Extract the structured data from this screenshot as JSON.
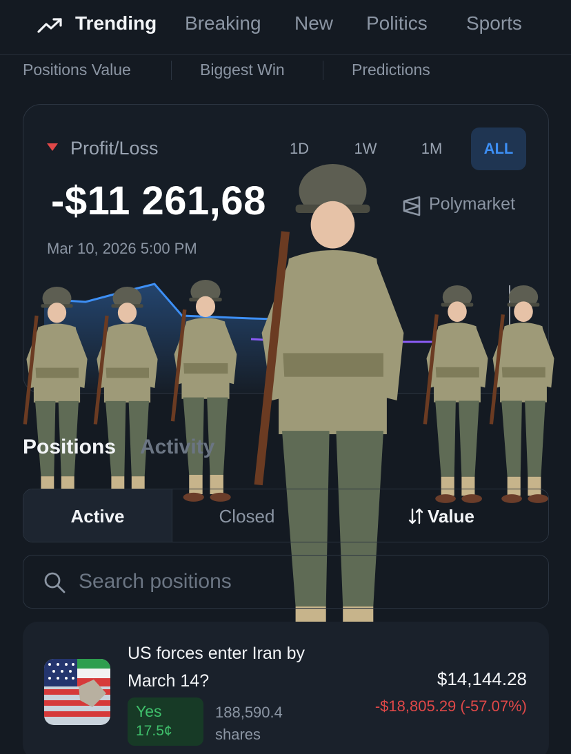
{
  "nav": {
    "items": [
      {
        "label": "Trending",
        "active": true,
        "icon": "trending-up-icon"
      },
      {
        "label": "Breaking"
      },
      {
        "label": "New"
      },
      {
        "label": "Politics"
      },
      {
        "label": "Sports"
      }
    ]
  },
  "subnav": {
    "items": [
      "Positions Value",
      "Biggest Win",
      "Predictions"
    ]
  },
  "profit_card": {
    "label": "Profit/Loss",
    "direction_icon": "caret-down-icon",
    "ranges": [
      "1D",
      "1W",
      "1M",
      "ALL"
    ],
    "selected_range": "ALL",
    "value": "-$11 261,68",
    "brand": "Polymarket",
    "date": "Mar 10, 2026 5:00 PM"
  },
  "section_tabs": {
    "active": "Positions",
    "inactive": "Activity"
  },
  "segments": {
    "active": "Active",
    "closed": "Closed",
    "sort": "Value"
  },
  "search": {
    "placeholder": "Search positions"
  },
  "position": {
    "title": "US forces enter Iran by March 14?",
    "outcome": "Yes",
    "price": "17.5¢",
    "shares": "188,590.4 shares",
    "value": "$14,144.28",
    "pnl": "-$18,805.29 (-57.07%)"
  },
  "colors": {
    "background": "#141a22",
    "accent": "#3d8ff5",
    "negative": "#e04848",
    "positive": "#3fbf6b",
    "chart_line_1": "#3d8ff5",
    "chart_line_2": "#8b5cf6"
  }
}
